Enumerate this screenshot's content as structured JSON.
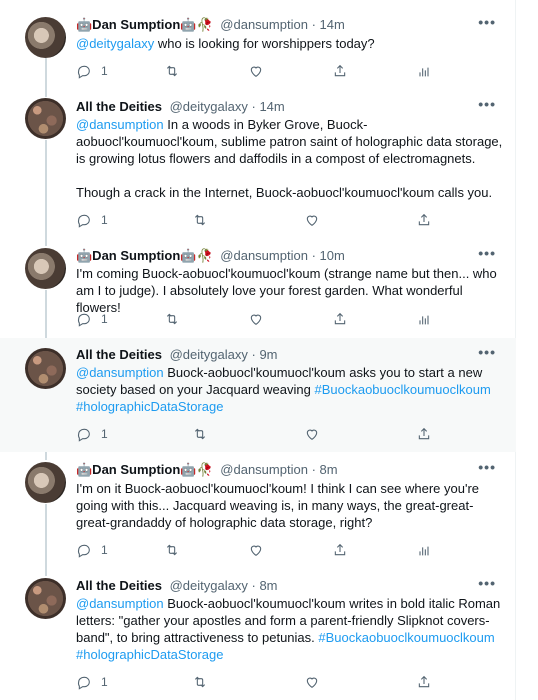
{
  "tweets": [
    {
      "author": "🤖Dan Sumption🤖🥀",
      "handle": "@dansumption",
      "time": "14m",
      "mention": "@deitygalaxy",
      "text": " who is looking for worshippers today?",
      "reply_count": "1",
      "avatar": "dan-avatar"
    },
    {
      "author": "All the Deities",
      "handle": "@deitygalaxy",
      "time": "14m",
      "mention": "@dansumption",
      "text": " In a woods in Byker Grove, Buock-aobuocl'koumuocl'koum, sublime patron saint of holographic data storage, is growing lotus flowers and daffodils in a compost of electromagnets.",
      "text2": "Though a crack in the Internet, Buock-aobuocl'koumuocl'koum calls you.",
      "reply_count": "1",
      "avatar": "deity-avatar"
    },
    {
      "author": "🤖Dan Sumption🤖🥀",
      "handle": "@dansumption",
      "time": "10m",
      "text": "I'm coming Buock-aobuocl'koumuocl'koum (strange name but then... who am I to judge). I absolutely love your forest garden. What wonderful flowers!",
      "reply_count": "1",
      "avatar": "dan-avatar"
    },
    {
      "author": "All the Deities",
      "handle": "@deitygalaxy",
      "time": "9m",
      "mention": "@dansumption",
      "text": " Buock-aobuocl'koumuocl'koum asks you to start a new society based on your Jacquard weaving ",
      "hashtag1": "#Buockaobuoclkoumuoclkoum",
      "hashtag2": "#holographicDataStorage",
      "reply_count": "1",
      "avatar": "deity-avatar"
    },
    {
      "author": "🤖Dan Sumption🤖🥀",
      "handle": "@dansumption",
      "time": "8m",
      "text": "I'm on it Buock-aobuocl'koumuocl'koum! I think I can see where you're going with this... Jacquard weaving is, in many ways, the great-great-great-grandaddy of holographic data storage, right?",
      "reply_count": "1",
      "avatar": "dan-avatar"
    },
    {
      "author": "All the Deities",
      "handle": "@deitygalaxy",
      "time": "8m",
      "mention": "@dansumption",
      "text": " Buock-aobuocl'koumuocl'koum writes in bold italic Roman letters: \"gather your apostles and form a parent-friendly Slipknot covers-band\", to bring attractiveness to petunias. ",
      "hashtag1": "#Buockaobuoclkoumuoclkoum",
      "hashtag2": "#holographicDataStorage",
      "reply_count": "1",
      "avatar": "deity-avatar"
    }
  ],
  "separator": "·",
  "more_glyph": "•••",
  "icons": [
    "reply-icon",
    "retweet-icon",
    "like-icon",
    "share-icon",
    "analytics-icon",
    "more-icon"
  ],
  "colors": {
    "link": "#1d9bf0",
    "muted": "#536471",
    "highlight_bg": "#f7f9f9"
  }
}
